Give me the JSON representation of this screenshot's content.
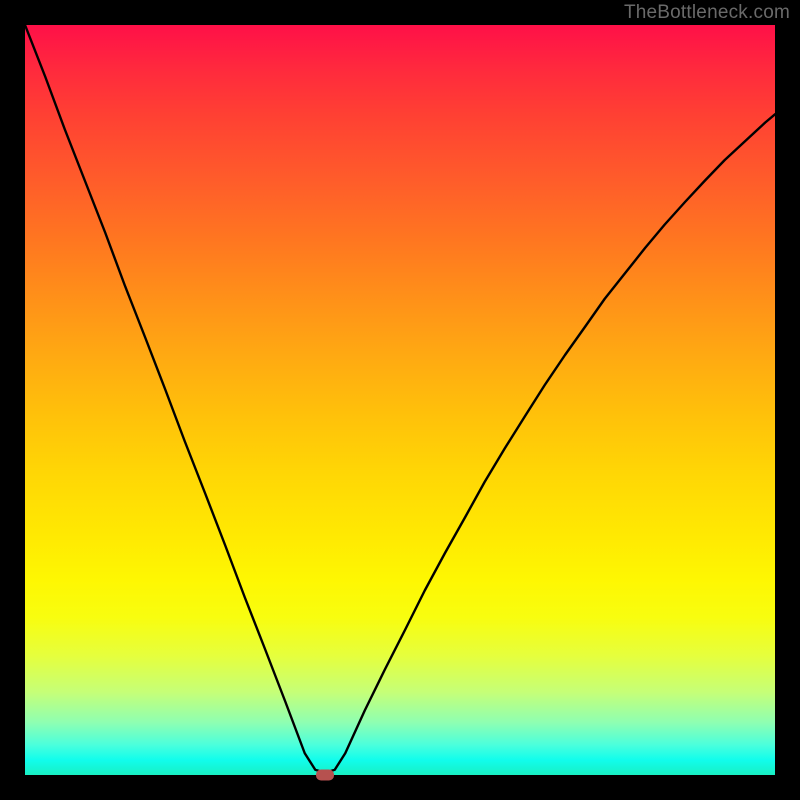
{
  "watermark": "TheBottleneck.com",
  "chart_data": {
    "type": "line",
    "title": "",
    "xlabel": "",
    "ylabel": "",
    "xlim": [
      0,
      100
    ],
    "ylim": [
      0,
      100
    ],
    "grid": false,
    "series": [
      {
        "name": "bottleneck-curve",
        "x": [
          0,
          2.7,
          5.3,
          8.0,
          10.7,
          13.3,
          16.0,
          18.7,
          21.3,
          24.0,
          26.7,
          29.3,
          32.0,
          34.7,
          37.3,
          38.7,
          40.0,
          41.3,
          42.7,
          45.3,
          48.0,
          50.7,
          53.3,
          56.0,
          58.7,
          61.3,
          64.0,
          66.7,
          69.3,
          72.0,
          74.7,
          77.3,
          80.0,
          82.7,
          85.3,
          88.0,
          90.7,
          93.3,
          96.0,
          98.7,
          100.0
        ],
        "y": [
          100.0,
          93.1,
          86.1,
          79.2,
          72.3,
          65.3,
          58.4,
          51.4,
          44.5,
          37.6,
          30.6,
          23.7,
          16.8,
          9.8,
          2.9,
          0.7,
          0.3,
          0.7,
          2.9,
          8.6,
          14.1,
          19.4,
          24.6,
          29.6,
          34.4,
          39.1,
          43.6,
          47.9,
          52.0,
          56.0,
          59.8,
          63.5,
          66.9,
          70.3,
          73.4,
          76.4,
          79.3,
          82.0,
          84.5,
          87.0,
          88.1
        ]
      }
    ],
    "annotations": [
      {
        "name": "optimum-marker",
        "x": 40.0,
        "y": 0.0
      }
    ],
    "background": "red-yellow-green vertical gradient"
  },
  "colors": {
    "curve": "#000000",
    "marker": "#b6514f",
    "frame": "#000000"
  }
}
